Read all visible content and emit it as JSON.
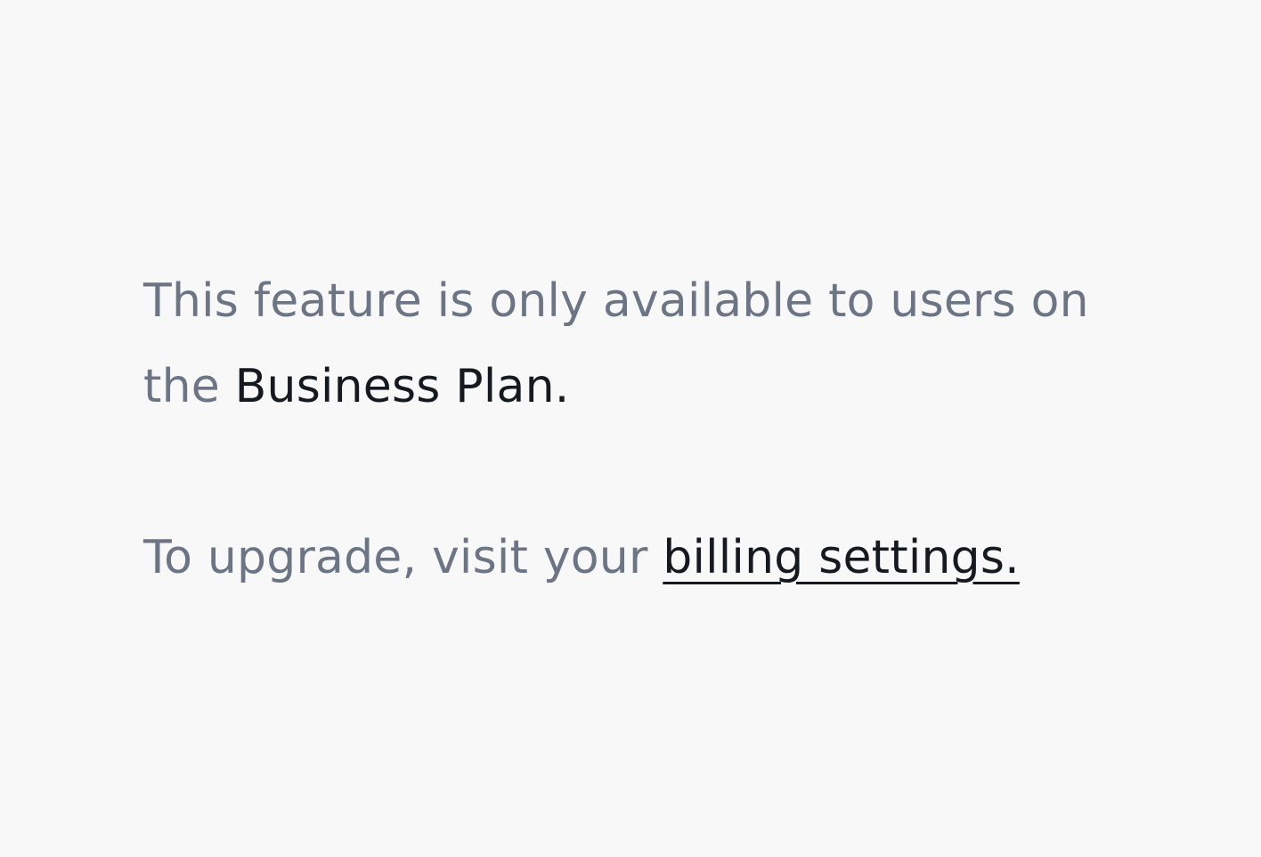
{
  "notice": {
    "text_before": "This feature is only available to users on the ",
    "plan_name": "Business Plan."
  },
  "upgrade": {
    "text_before": "To upgrade, visit your ",
    "link_label": "billing settings."
  },
  "colors": {
    "background": "#f8f8f8",
    "muted_text": "#6b7585",
    "emphasis_text": "#151a21"
  }
}
